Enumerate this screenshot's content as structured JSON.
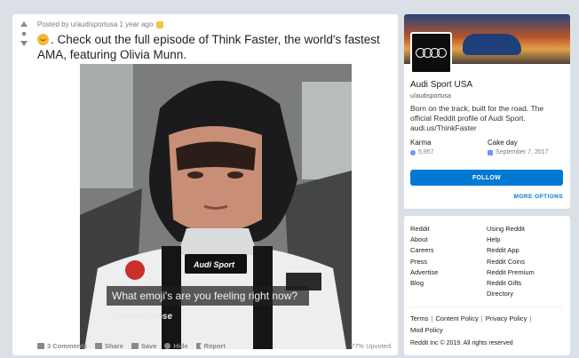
{
  "post": {
    "meta": "Posted by u/audisportusa 1 year ago",
    "title": ". Check out the full episode of Think Faster, the world's fastest AMA, featuring Olivia Munn.",
    "caption": "What emoji's are you feeling right now?",
    "watermark": "GregoryGoose",
    "suit_patch_text": "Audi Sport",
    "actions": {
      "comments": "3 Comments",
      "share": "Share",
      "save": "Save",
      "hide": "Hide",
      "report": "Report"
    },
    "upvoted": "77% Upvoted"
  },
  "community": {
    "name": "Audi Sport USA",
    "handle": "u/audisportusa",
    "description": "Born on the track, built for the road. The official Reddit profile of Audi Sport. audi.us/ThinkFaster",
    "karma_label": "Karma",
    "karma_value": "5,957",
    "cakeday_label": "Cake day",
    "cakeday_value": "September 7, 2017",
    "follow_label": "FOLLOW",
    "more_options_label": "MORE OPTIONS"
  },
  "footer": {
    "reddit_heading": "Reddit",
    "reddit_links": [
      "About",
      "Careers",
      "Press",
      "Advertise",
      "Blog"
    ],
    "using_heading": "Using Reddit",
    "using_links": [
      "Help",
      "Reddit App",
      "Reddit Coins",
      "Reddit Premium",
      "Reddit Gifts",
      "Directory"
    ],
    "policy_terms": "Terms",
    "policy_content": "Content Policy",
    "policy_privacy": "Privacy Policy",
    "policy_mod": "Mod Policy",
    "copyright": "Reddit Inc © 2019. All rights reserved"
  },
  "colors": {
    "accent": "#0079d3",
    "background": "#dae0e6",
    "icon_gray": "#878a8c"
  },
  "icons": [
    "upvote-icon",
    "downvote-icon",
    "award-icon",
    "emoji-icon",
    "comment-icon",
    "share-icon",
    "save-icon",
    "hide-icon",
    "report-icon",
    "karma-icon",
    "cake-icon",
    "audi-rings-logo"
  ]
}
